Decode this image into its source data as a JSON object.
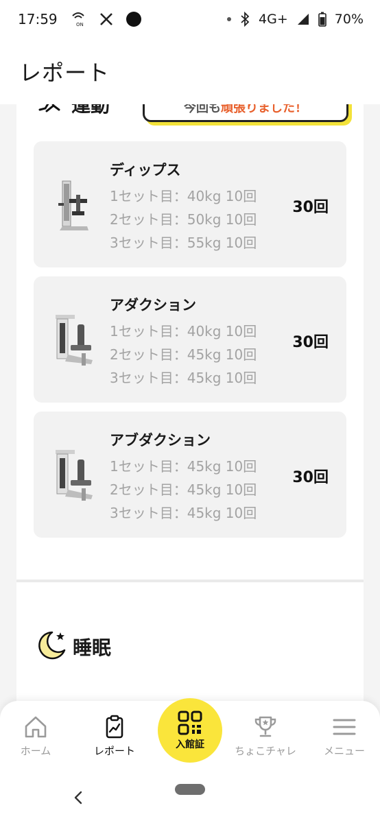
{
  "status_bar": {
    "time": "17:59",
    "network": "4G+",
    "battery": "70%"
  },
  "header": {
    "title": "レポート"
  },
  "exercise": {
    "title": "運動",
    "bubble_prefix": "今回も",
    "bubble_highlight": "頑張りました！",
    "cards": [
      {
        "name": "ディップス",
        "sets": [
          "1セット目：40kg 10回",
          "2セット目：50kg 10回",
          "3セット目：55kg 10回"
        ],
        "total": "30回"
      },
      {
        "name": "アダクション",
        "sets": [
          "1セット目：40kg 10回",
          "2セット目：45kg 10回",
          "3セット目：45kg 10回"
        ],
        "total": "30回"
      },
      {
        "name": "アブダクション",
        "sets": [
          "1セット目：45kg 10回",
          "2セット目：45kg 10回",
          "3セット目：45kg 10回"
        ],
        "total": "30回"
      }
    ]
  },
  "sleep": {
    "title": "睡眠"
  },
  "bottom_nav": {
    "home": "ホーム",
    "report": "レポート",
    "entry": "入館証",
    "challenge": "ちょこチャレ",
    "menu": "メニュー"
  },
  "colors": {
    "accent_yellow": "#fae53b",
    "highlight_orange": "#e8602c",
    "card_bg": "#f2f2f2"
  }
}
